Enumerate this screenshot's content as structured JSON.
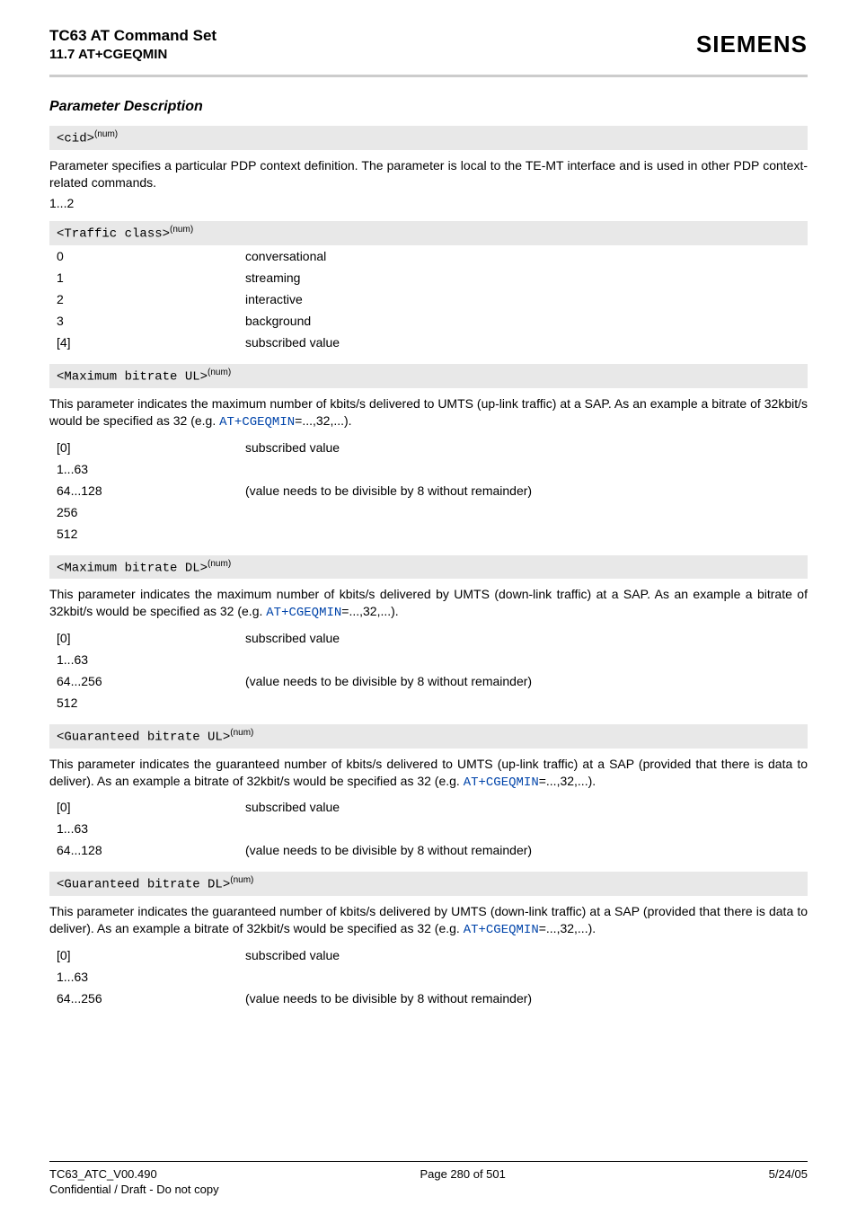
{
  "header": {
    "title": "TC63 AT Command Set",
    "subtitle": "11.7 AT+CGEQMIN",
    "brand": "SIEMENS"
  },
  "section_title": "Parameter Description",
  "params": {
    "cid": {
      "name": "<cid>",
      "sup": "(num)",
      "desc": "Parameter specifies a particular PDP context definition. The parameter is local to the TE-MT interface and is used in other PDP context-related commands.",
      "range": "1...2"
    },
    "traffic_class": {
      "name": "<Traffic class>",
      "sup": "(num)",
      "rows": [
        {
          "k": "0",
          "v": "conversational"
        },
        {
          "k": "1",
          "v": "streaming"
        },
        {
          "k": "2",
          "v": "interactive"
        },
        {
          "k": "3",
          "v": "background"
        },
        {
          "k": "[4]",
          "v": "subscribed value"
        }
      ]
    },
    "max_ul": {
      "name": "<Maximum bitrate UL>",
      "sup": "(num)",
      "desc_pre": "This parameter indicates the maximum number of kbits/s delivered to UMTS (up-link traffic) at a SAP. As an example a bitrate of 32kbit/s would be specified as 32 (e.g. ",
      "cmd": "AT+CGEQMIN",
      "desc_post": "=...,32,...).",
      "rows": [
        {
          "k": "[0]",
          "v": "subscribed value"
        },
        {
          "k": "1...63",
          "v": ""
        },
        {
          "k": "64...128",
          "v": "(value needs to be divisible by 8 without remainder)"
        },
        {
          "k": "256",
          "v": ""
        },
        {
          "k": "512",
          "v": ""
        }
      ]
    },
    "max_dl": {
      "name": "<Maximum bitrate DL>",
      "sup": "(num)",
      "desc_pre": "This parameter indicates the maximum number of kbits/s delivered by UMTS (down-link traffic) at a SAP. As an example a bitrate of 32kbit/s would be specified as 32 (e.g. ",
      "cmd": "AT+CGEQMIN",
      "desc_post": "=...,32,...).",
      "rows": [
        {
          "k": "[0]",
          "v": "subscribed value"
        },
        {
          "k": "1...63",
          "v": ""
        },
        {
          "k": "64...256",
          "v": "(value needs to be divisible by 8 without remainder)"
        },
        {
          "k": "512",
          "v": ""
        }
      ]
    },
    "gua_ul": {
      "name": "<Guaranteed bitrate UL>",
      "sup": "(num)",
      "desc_pre": "This parameter indicates the guaranteed number of kbits/s delivered to UMTS (up-link traffic) at a SAP (provided that there is data to deliver). As an example a bitrate of 32kbit/s would be specified as 32 (e.g. ",
      "cmd": "AT+CGEQMIN",
      "desc_post": "=...,32,...).",
      "rows": [
        {
          "k": "[0]",
          "v": "subscribed value"
        },
        {
          "k": "1...63",
          "v": ""
        },
        {
          "k": "64...128",
          "v": "(value needs to be divisible by 8 without remainder)"
        }
      ]
    },
    "gua_dl": {
      "name": "<Guaranteed bitrate DL>",
      "sup": "(num)",
      "desc_pre": "This parameter indicates the guaranteed number of kbits/s delivered by UMTS (down-link traffic) at a SAP (provided that there is data to deliver). As an example a bitrate of 32kbit/s would be specified as 32 (e.g. ",
      "cmd": "AT+CGEQMIN",
      "desc_post": "=...,32,...).",
      "rows": [
        {
          "k": "[0]",
          "v": "subscribed value"
        },
        {
          "k": "1...63",
          "v": ""
        },
        {
          "k": "64...256",
          "v": "(value needs to be divisible by 8 without remainder)"
        }
      ]
    }
  },
  "footer": {
    "left": "TC63_ATC_V00.490",
    "center": "Page 280 of 501",
    "right": "5/24/05",
    "sub": "Confidential / Draft - Do not copy"
  }
}
